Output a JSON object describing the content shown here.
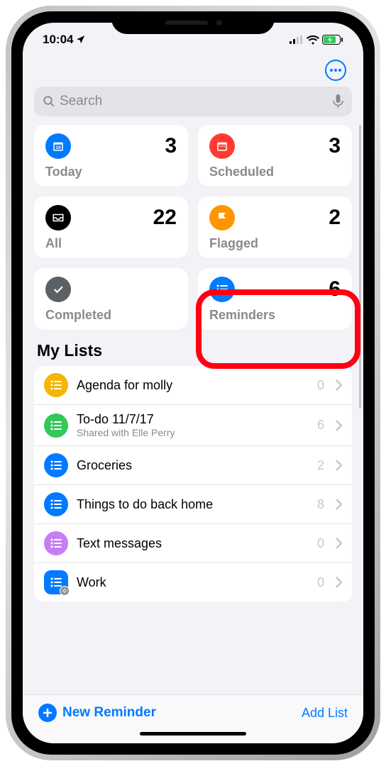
{
  "status": {
    "time": "10:04"
  },
  "search": {
    "placeholder": "Search"
  },
  "cards": {
    "today": {
      "label": "Today",
      "count": "3"
    },
    "scheduled": {
      "label": "Scheduled",
      "count": "3"
    },
    "all": {
      "label": "All",
      "count": "22"
    },
    "flagged": {
      "label": "Flagged",
      "count": "2"
    },
    "completed": {
      "label": "Completed",
      "count": ""
    },
    "reminders": {
      "label": "Reminders",
      "count": "6"
    }
  },
  "section_title": "My Lists",
  "lists": [
    {
      "title": "Agenda for molly",
      "sub": "",
      "count": "0",
      "color": "yellow"
    },
    {
      "title": "To-do 11/7/17",
      "sub": "Shared with Elle Perry",
      "count": "6",
      "color": "green"
    },
    {
      "title": "Groceries",
      "sub": "",
      "count": "2",
      "color": "blue"
    },
    {
      "title": "Things to do back home",
      "sub": "",
      "count": "8",
      "color": "blue"
    },
    {
      "title": "Text messages",
      "sub": "",
      "count": "0",
      "color": "purple"
    },
    {
      "title": "Work",
      "sub": "",
      "count": "0",
      "color": "bluegear"
    }
  ],
  "bottom": {
    "new_reminder": "New Reminder",
    "add_list": "Add List"
  },
  "highlight": "cards.reminders"
}
